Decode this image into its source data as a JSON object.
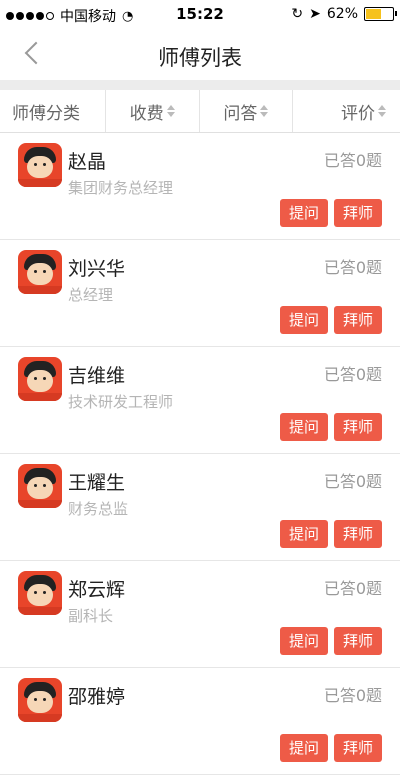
{
  "status_bar": {
    "carrier": "中国移动",
    "time": "15:22",
    "battery": "62%",
    "battery_level": 0.62,
    "battery_color": "#f6c21c"
  },
  "nav": {
    "title": "师傅列表"
  },
  "filters": [
    {
      "label": "师傅分类",
      "sortable": false
    },
    {
      "label": "收费",
      "sortable": true
    },
    {
      "label": "问答",
      "sortable": true
    },
    {
      "label": "评价",
      "sortable": true
    }
  ],
  "buttons": {
    "ask": "提问",
    "follow": "拜师"
  },
  "colors": {
    "accent": "#ee5b47"
  },
  "masters": [
    {
      "name": "赵晶",
      "title": "集团财务总经理",
      "answered": "已答0题"
    },
    {
      "name": "刘兴华",
      "title": "总经理",
      "answered": "已答0题"
    },
    {
      "name": "吉维维",
      "title": "技术研发工程师",
      "answered": "已答0题"
    },
    {
      "name": "王耀生",
      "title": "财务总监",
      "answered": "已答0题"
    },
    {
      "name": "郑云辉",
      "title": "副科长",
      "answered": "已答0题"
    },
    {
      "name": "邵雅婷",
      "title": "",
      "answered": "已答0题"
    }
  ]
}
